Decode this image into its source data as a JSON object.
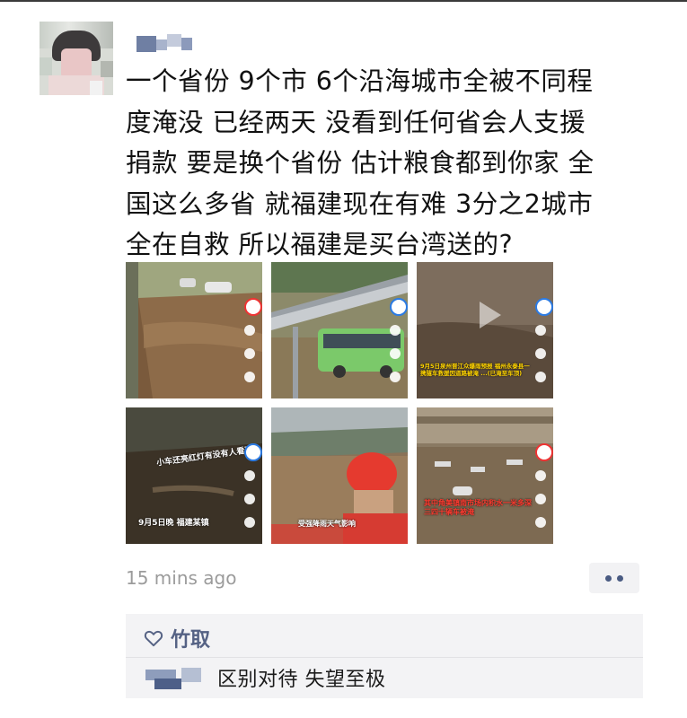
{
  "post": {
    "author_name_redacted": true,
    "text": "一个省份 9个市 6个沿海城市全被不同程\n度淹没 已经两天 没看到任何省会人支援\n捐款 要是换个省份 估计粮食都到你家 全\n国这么多省 就福建现在有难 3分之2城市\n全在自救 所以福建是买台湾送的?",
    "time": "15 mins ago",
    "more_icon": "more-dots-icon",
    "images": [
      {
        "caption": ""
      },
      {
        "caption": ""
      },
      {
        "caption": "9月5日泉州晋江众爆雨预报 福州永泰县一携隧车救援因道路被淹 ...(已淹至车顶)"
      },
      {
        "caption": "小车还亮红灯有没有人看到",
        "caption2": "9月5日晚 福建某镇"
      },
      {
        "caption": "受强降雨天气影响"
      },
      {
        "caption": "其中角美镇南市场内积水一米多深 三四十辆车被淹"
      }
    ]
  },
  "interactions": {
    "like_icon": "heart-outline-icon",
    "liked_by": "竹取",
    "comments": [
      {
        "author_redacted": true,
        "text": "区别对待 失望至极"
      }
    ]
  },
  "colors": {
    "link_name": "#556284",
    "comment_bg": "#f3f3f5",
    "timestamp": "#9b9b9b"
  }
}
